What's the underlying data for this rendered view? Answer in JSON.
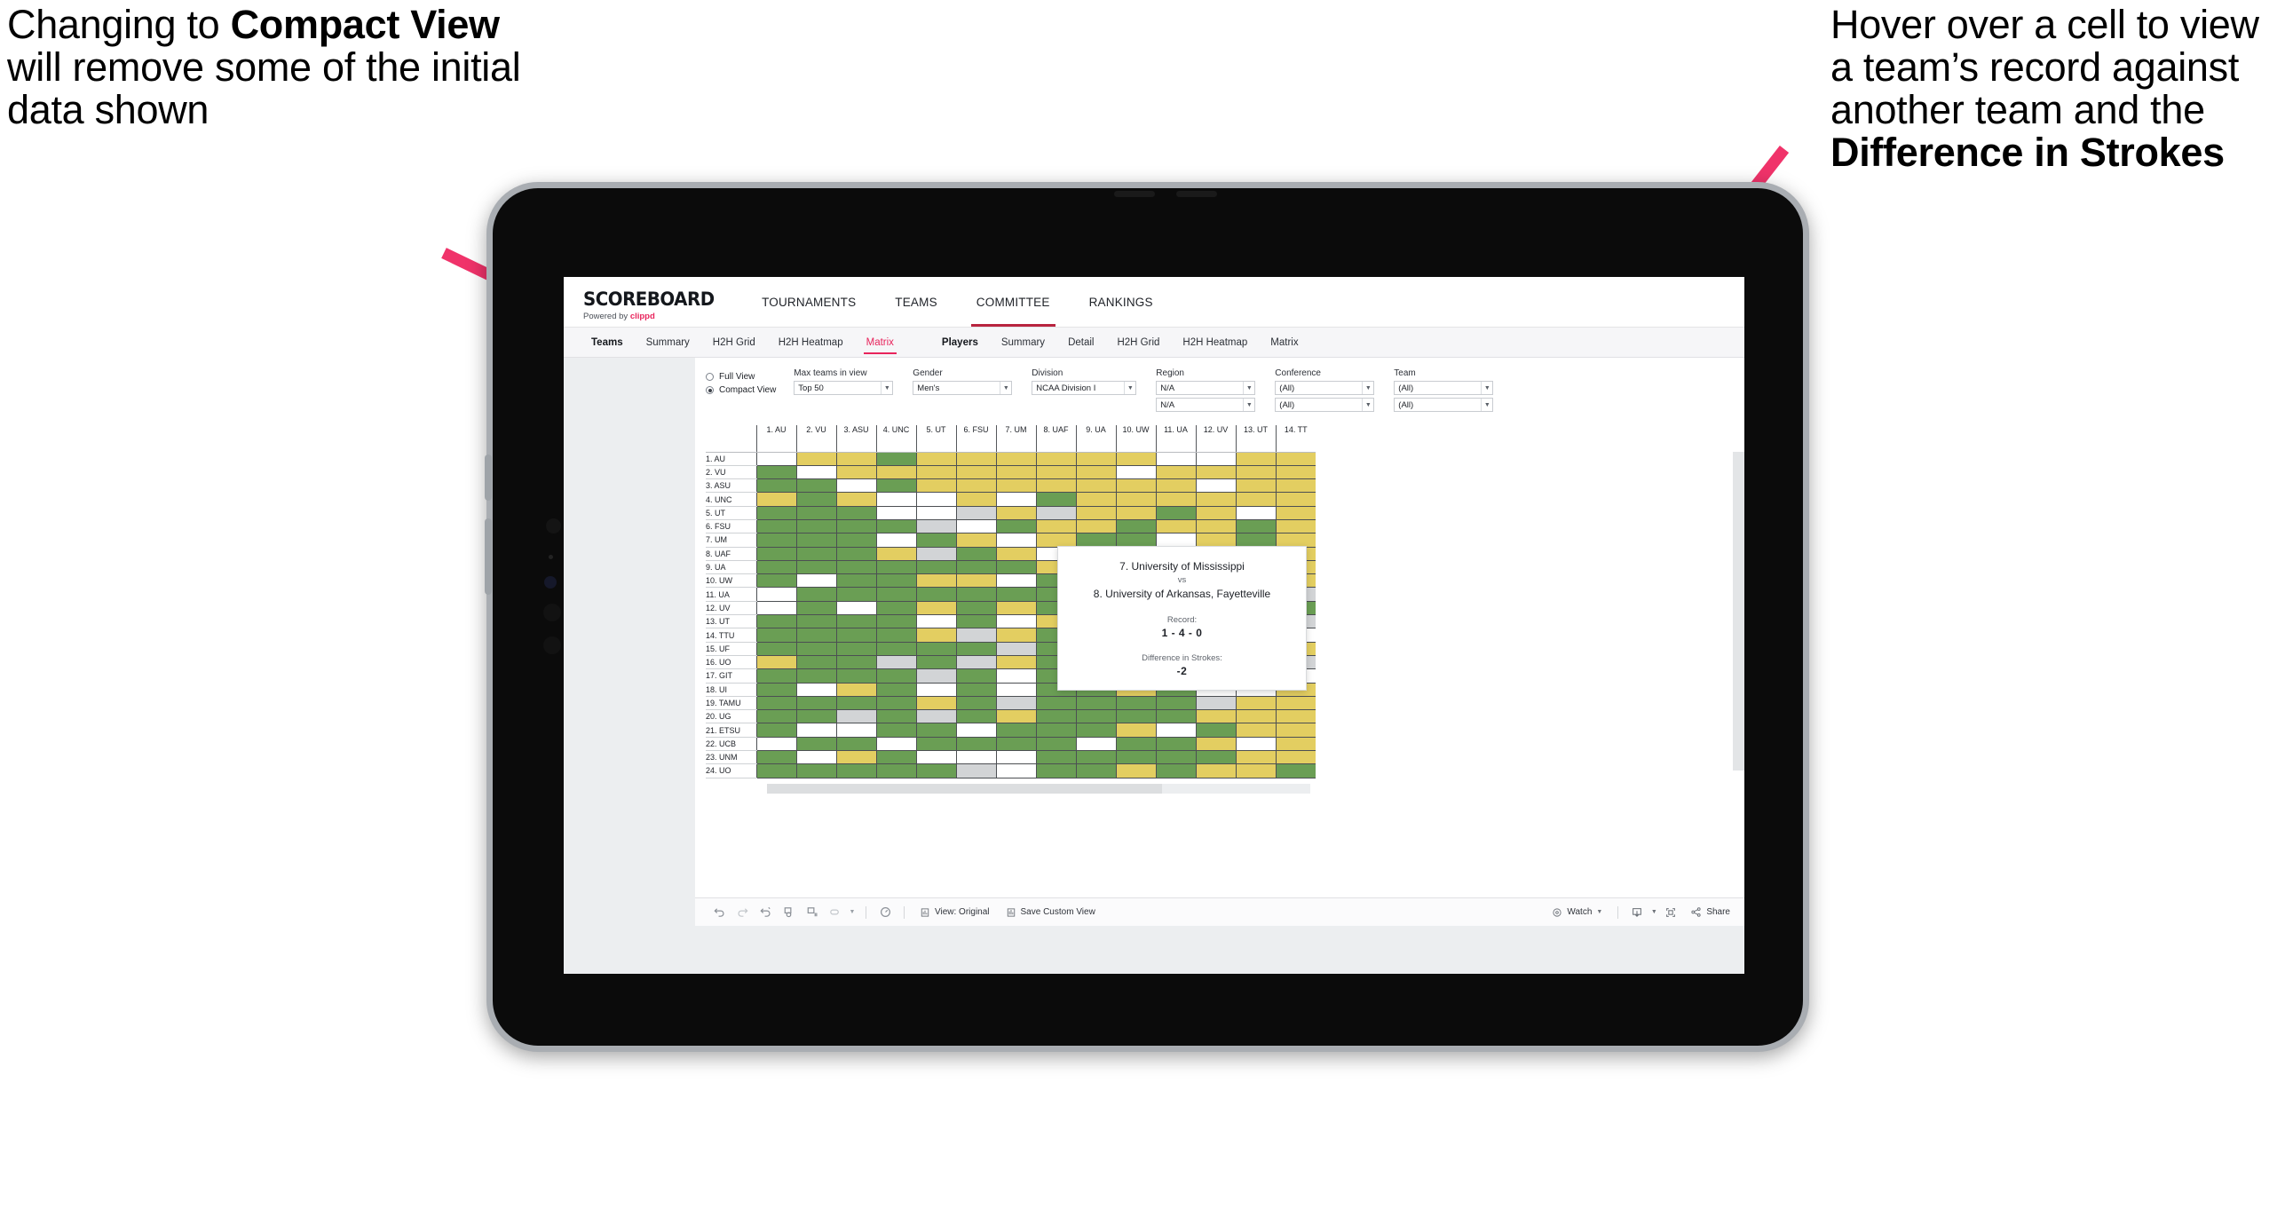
{
  "annotations": {
    "left": {
      "pre": "Changing to ",
      "bold": "Compact View",
      "post": " will remove some of the initial data shown"
    },
    "right": {
      "pre": "Hover over a cell to view a team’s record against another team and the ",
      "bold": "Difference in Strokes",
      "post": ""
    }
  },
  "app": {
    "logo": {
      "main": "SCOREBOARD",
      "sub_pre": "Powered by ",
      "sub_brand": "clippd"
    },
    "topnav": [
      {
        "label": "TOURNAMENTS",
        "active": false
      },
      {
        "label": "TEAMS",
        "active": false
      },
      {
        "label": "COMMITTEE",
        "active": true
      },
      {
        "label": "RANKINGS",
        "active": false
      }
    ],
    "subnav_teams": [
      {
        "label": "Teams",
        "head": true,
        "selected": false
      },
      {
        "label": "Summary",
        "head": false,
        "selected": false
      },
      {
        "label": "H2H Grid",
        "head": false,
        "selected": false
      },
      {
        "label": "H2H Heatmap",
        "head": false,
        "selected": false
      },
      {
        "label": "Matrix",
        "head": false,
        "selected": true
      }
    ],
    "subnav_players": [
      {
        "label": "Players",
        "head": true,
        "selected": false
      },
      {
        "label": "Summary",
        "head": false,
        "selected": false
      },
      {
        "label": "Detail",
        "head": false,
        "selected": false
      },
      {
        "label": "H2H Grid",
        "head": false,
        "selected": false
      },
      {
        "label": "H2H Heatmap",
        "head": false,
        "selected": false
      },
      {
        "label": "Matrix",
        "head": false,
        "selected": false
      }
    ]
  },
  "filters": {
    "view_mode": {
      "options": [
        "Full View",
        "Compact View"
      ],
      "selected": "Compact View"
    },
    "max_teams": {
      "label": "Max teams in view",
      "value": "Top 50"
    },
    "gender": {
      "label": "Gender",
      "value": "Men's"
    },
    "division": {
      "label": "Division",
      "value": "NCAA Division I"
    },
    "region": {
      "label": "Region",
      "value1": "N/A",
      "value2": "N/A"
    },
    "conference": {
      "label": "Conference",
      "value1": "(All)",
      "value2": "(All)"
    },
    "team": {
      "label": "Team",
      "value1": "(All)",
      "value2": "(All)"
    }
  },
  "chart_data": {
    "type": "heatmap",
    "title": "Head-to-Head Team Matrix",
    "xlabel": "",
    "ylabel": "",
    "grid": true,
    "legend_position": "none",
    "color_map": {
      "g": "#6a9e54",
      "y": "#e3ce61",
      "w": "#ffffff",
      "a": "#d2d4d6"
    },
    "color_meaning": {
      "g": "winning record",
      "y": "losing record",
      "w": "no matchup / self",
      "a": "even record"
    },
    "categories": [
      "1. AU",
      "2. VU",
      "3. ASU",
      "4. UNC",
      "5. UT",
      "6. FSU",
      "7. UM",
      "8. UAF",
      "9. UA",
      "10. UW",
      "11. UA",
      "12. UV",
      "13. UT",
      "14. TT"
    ],
    "row_labels": [
      "1. AU",
      "2. VU",
      "3. ASU",
      "4. UNC",
      "5. UT",
      "6. FSU",
      "7. UM",
      "8. UAF",
      "9. UA",
      "10. UW",
      "11. UA",
      "12. UV",
      "13. UT",
      "14. TTU",
      "15. UF",
      "16. UO",
      "17. GIT",
      "18. UI",
      "19. TAMU",
      "20. UG",
      "21. ETSU",
      "22. UCB",
      "23. UNM",
      "24. UO"
    ],
    "values": [
      [
        "w",
        "y",
        "y",
        "g",
        "y",
        "y",
        "y",
        "y",
        "y",
        "y",
        "w",
        "w",
        "y",
        "y"
      ],
      [
        "g",
        "w",
        "y",
        "y",
        "y",
        "y",
        "y",
        "y",
        "y",
        "w",
        "y",
        "y",
        "y",
        "y"
      ],
      [
        "g",
        "g",
        "w",
        "g",
        "y",
        "y",
        "y",
        "y",
        "y",
        "y",
        "y",
        "w",
        "y",
        "y"
      ],
      [
        "y",
        "g",
        "y",
        "w",
        "w",
        "y",
        "w",
        "g",
        "y",
        "y",
        "y",
        "y",
        "y",
        "y"
      ],
      [
        "g",
        "g",
        "g",
        "w",
        "w",
        "a",
        "y",
        "a",
        "y",
        "y",
        "g",
        "y",
        "w",
        "y"
      ],
      [
        "g",
        "g",
        "g",
        "g",
        "a",
        "w",
        "g",
        "y",
        "y",
        "g",
        "y",
        "y",
        "g",
        "y"
      ],
      [
        "g",
        "g",
        "g",
        "w",
        "g",
        "y",
        "w",
        "y",
        "g",
        "g",
        "w",
        "y",
        "g",
        "y"
      ],
      [
        "g",
        "g",
        "g",
        "y",
        "a",
        "g",
        "y",
        "w",
        "g",
        "y",
        "g",
        "y",
        "y",
        "y"
      ],
      [
        "g",
        "g",
        "g",
        "g",
        "g",
        "g",
        "g",
        "y",
        "w",
        "g",
        "g",
        "y",
        "g",
        "y"
      ],
      [
        "g",
        "w",
        "g",
        "g",
        "y",
        "y",
        "w",
        "g",
        "y",
        "w",
        "y",
        "w",
        "y",
        "y"
      ],
      [
        "w",
        "g",
        "g",
        "g",
        "g",
        "g",
        "g",
        "g",
        "y",
        "g",
        "w",
        "y",
        "g",
        "a"
      ],
      [
        "w",
        "g",
        "w",
        "g",
        "y",
        "g",
        "y",
        "g",
        "g",
        "g",
        "g",
        "w",
        "y",
        "g"
      ],
      [
        "g",
        "g",
        "g",
        "g",
        "w",
        "g",
        "w",
        "y",
        "w",
        "y",
        "g",
        "g",
        "w",
        "a"
      ],
      [
        "g",
        "g",
        "g",
        "g",
        "y",
        "a",
        "y",
        "g",
        "g",
        "a",
        "w",
        "y",
        "a",
        "w"
      ],
      [
        "g",
        "g",
        "g",
        "g",
        "g",
        "g",
        "a",
        "g",
        "g",
        "g",
        "y",
        "g",
        "y",
        "y"
      ],
      [
        "y",
        "g",
        "g",
        "a",
        "g",
        "a",
        "y",
        "g",
        "g",
        "y",
        "g",
        "a",
        "w",
        "a"
      ],
      [
        "g",
        "g",
        "g",
        "g",
        "a",
        "g",
        "w",
        "g",
        "g",
        "g",
        "y",
        "g",
        "w",
        "w"
      ],
      [
        "g",
        "w",
        "y",
        "g",
        "w",
        "g",
        "w",
        "g",
        "g",
        "y",
        "g",
        "w",
        "w",
        "y"
      ],
      [
        "g",
        "g",
        "g",
        "g",
        "y",
        "g",
        "a",
        "g",
        "g",
        "g",
        "g",
        "a",
        "y",
        "y"
      ],
      [
        "g",
        "g",
        "a",
        "g",
        "a",
        "g",
        "y",
        "g",
        "g",
        "g",
        "g",
        "y",
        "y",
        "y"
      ],
      [
        "g",
        "w",
        "w",
        "g",
        "g",
        "w",
        "g",
        "g",
        "g",
        "y",
        "w",
        "g",
        "y",
        "y"
      ],
      [
        "w",
        "g",
        "g",
        "w",
        "g",
        "g",
        "g",
        "g",
        "w",
        "g",
        "g",
        "y",
        "w",
        "y"
      ],
      [
        "g",
        "w",
        "y",
        "g",
        "w",
        "w",
        "w",
        "g",
        "g",
        "g",
        "g",
        "g",
        "y",
        "y"
      ],
      [
        "g",
        "g",
        "g",
        "g",
        "g",
        "a",
        "w",
        "g",
        "g",
        "y",
        "g",
        "y",
        "y",
        "g"
      ]
    ]
  },
  "tooltip": {
    "team_a": "7. University of Mississippi",
    "vs": "vs",
    "team_b": "8. University of Arkansas, Fayetteville",
    "record_label": "Record:",
    "record_value": "1 - 4 - 0",
    "diff_label": "Difference in Strokes:",
    "diff_value": "-2"
  },
  "toolbar": {
    "icons": [
      "undo-icon",
      "redo-icon",
      "revert-icon",
      "refresh-icon",
      "pause-icon",
      "highlight-icon"
    ],
    "alert_icon": "alert-icon",
    "view_original": "View: Original",
    "save_custom_view": "Save Custom View",
    "watch": "Watch",
    "download_icon": "download-icon",
    "fullscreen_icon": "fullscreen-icon",
    "share": "Share"
  }
}
